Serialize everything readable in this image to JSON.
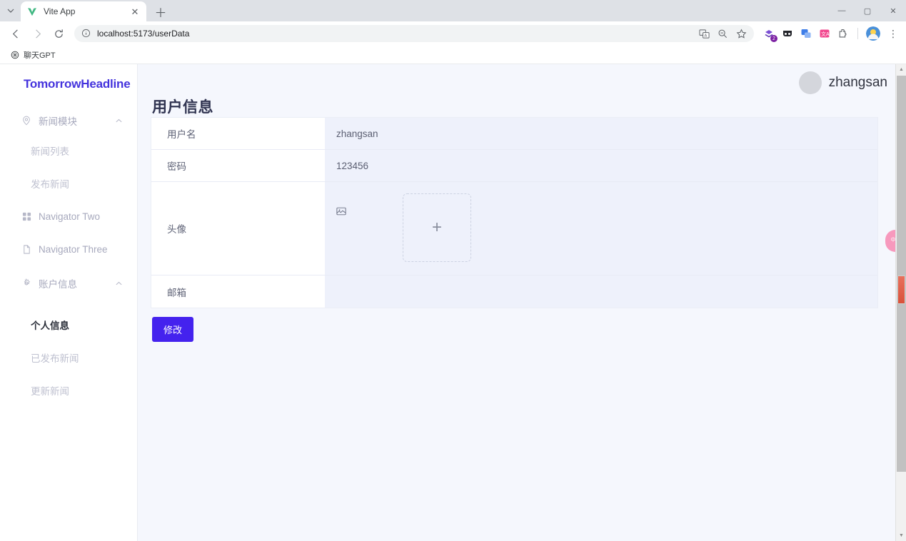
{
  "browser": {
    "tab": {
      "title": "Vite App",
      "favicon_icon": "vite-logo-icon",
      "close_icon": "close-icon"
    },
    "tab_list_icon": "chevron-down-icon",
    "new_tab_icon": "plus-icon",
    "window_controls": {
      "minimize": "minimize-icon",
      "maximize": "maximize-icon",
      "close": "close-icon"
    },
    "nav": {
      "back_icon": "back-arrow-icon",
      "forward_icon": "forward-arrow-icon",
      "reload_icon": "reload-icon"
    },
    "omnibox": {
      "info_icon": "info-circle-icon",
      "url": "localhost:5173/userData",
      "translate_icon": "translate-page-icon",
      "zoom_icon": "zoom-out-icon",
      "bookmark_icon": "star-icon"
    },
    "extensions": [
      {
        "name": "extension-purple-layers-icon",
        "badge": "2"
      },
      {
        "name": "extension-dark-glasses-icon",
        "badge": ""
      },
      {
        "name": "extension-blue-translate-icon",
        "badge": ""
      },
      {
        "name": "extension-pink-translate-icon",
        "badge": ""
      },
      {
        "name": "extension-puzzle-icon",
        "badge": ""
      }
    ],
    "profile_icon": "profile-avatar-icon",
    "menu_icon": "three-dot-menu-icon",
    "bookmarks": [
      {
        "label": "聊天GPT",
        "icon": "chatgpt-icon"
      }
    ]
  },
  "sidebar": {
    "brand": "TomorrowHeadline",
    "groups": [
      {
        "label": "新闻模块",
        "icon": "location-pin-icon",
        "chevron": "chevron-up-icon",
        "items": [
          {
            "label": "新闻列表",
            "active": false
          },
          {
            "label": "发布新闻",
            "active": false
          }
        ]
      }
    ],
    "items": [
      {
        "label": "Navigator Two",
        "icon": "grid-squares-icon"
      },
      {
        "label": "Navigator Three",
        "icon": "document-icon"
      }
    ],
    "account_group": {
      "label": "账户信息",
      "icon": "gear-icon",
      "chevron": "chevron-up-icon",
      "items": [
        {
          "label": "个人信息",
          "active": true
        },
        {
          "label": "已发布新闻",
          "active": false
        },
        {
          "label": "更新新闻",
          "active": false
        }
      ]
    }
  },
  "page": {
    "title": "用户信息",
    "user": {
      "name": "zhangsan",
      "avatar_icon": "user-avatar-icon"
    },
    "details": {
      "rows": [
        {
          "label": "用户名",
          "value": "zhangsan"
        },
        {
          "label": "密码",
          "value": "123456"
        },
        {
          "label": "头像",
          "value": ""
        },
        {
          "label": "邮箱",
          "value": ""
        }
      ]
    },
    "avatar_field": {
      "broken_image_icon": "broken-image-icon",
      "upload_icon": "plus-icon",
      "upload_label": ""
    },
    "modify_button": "修改",
    "translate_fab": {
      "icon": "translate-icon",
      "label": "中A"
    },
    "colors": {
      "brand": "#4433dd",
      "button": "#4422ee",
      "title": "#2f3350",
      "panel_bg": "#f5f7fd",
      "value_bg": "#eef1fb",
      "fab": "#f799bd"
    }
  }
}
